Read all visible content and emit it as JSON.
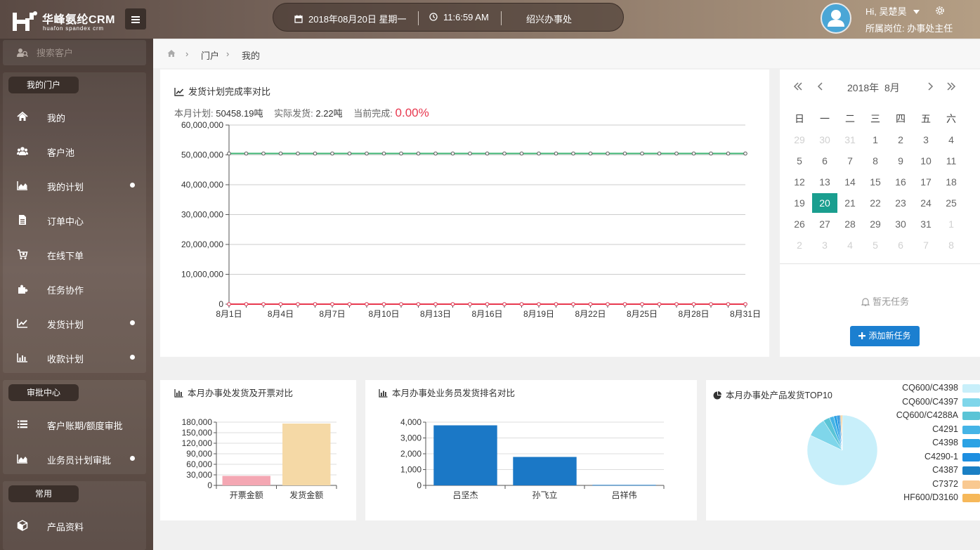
{
  "header": {
    "brand_title": "华峰氨纶CRM",
    "brand_subtitle": "huafon spandex crm",
    "menu_toggle_icon": "menu-icon",
    "date": "2018年08月20日 星期一",
    "time": "11:6:59 AM",
    "office": "绍兴办事处",
    "greeting": "Hi, 吴楚昊",
    "role": "所属岗位: 办事处主任"
  },
  "sidebar": {
    "search_placeholder": "搜索客户",
    "sections": [
      {
        "title": "我的门户",
        "items": [
          {
            "label": "我的",
            "icon": "home-icon",
            "dot": false
          },
          {
            "label": "客户池",
            "icon": "users-icon",
            "dot": false
          },
          {
            "label": "我的计划",
            "icon": "area-chart-icon",
            "dot": true
          },
          {
            "label": "订单中心",
            "icon": "document-icon",
            "dot": false
          },
          {
            "label": "在线下单",
            "icon": "cart-icon",
            "dot": false
          },
          {
            "label": "任务协作",
            "icon": "puzzle-icon",
            "dot": false
          },
          {
            "label": "发货计划",
            "icon": "line-chart-icon",
            "dot": true
          },
          {
            "label": "收款计划",
            "icon": "bar-chart-icon",
            "dot": true
          }
        ]
      },
      {
        "title": "审批中心",
        "items": [
          {
            "label": "客户账期/额度审批",
            "icon": "list-icon",
            "dot": false
          },
          {
            "label": "业务员计划审批",
            "icon": "area-chart-icon",
            "dot": true
          }
        ]
      },
      {
        "title": "常用",
        "items": [
          {
            "label": "产品资料",
            "icon": "cube-icon",
            "dot": false
          }
        ]
      }
    ]
  },
  "breadcrumb": {
    "items": [
      "门户",
      "我的"
    ]
  },
  "shipment_card": {
    "title": "发货计划完成率对比",
    "plan_label": "本月计划:",
    "plan_value": "50458.19吨",
    "actual_label": "实际发货:",
    "actual_value": "2.22吨",
    "complete_label": "当前完成:",
    "complete_value": "0.00%"
  },
  "calendar": {
    "year_label": "2018年",
    "month_label": "8月",
    "weekdays": [
      "日",
      "一",
      "二",
      "三",
      "四",
      "五",
      "六"
    ],
    "days": [
      [
        29,
        30,
        31,
        1,
        2,
        3,
        4
      ],
      [
        5,
        6,
        7,
        8,
        9,
        10,
        11
      ],
      [
        12,
        13,
        14,
        15,
        16,
        17,
        18
      ],
      [
        19,
        20,
        21,
        22,
        23,
        24,
        25
      ],
      [
        26,
        27,
        28,
        29,
        30,
        31,
        1
      ],
      [
        2,
        3,
        4,
        5,
        6,
        7,
        8
      ]
    ],
    "selected_day": 20,
    "no_task": "暂无任务",
    "add_task": "添加新任务"
  },
  "invoice_card": {
    "title": "本月办事处发货及开票对比"
  },
  "ranking_card": {
    "title": "本月办事处业务员发货排名对比"
  },
  "top10_card": {
    "title": "本月办事处产品发货TOP10"
  },
  "chart_data": [
    {
      "type": "line",
      "x": [
        "8月1日",
        "8月2日",
        "8月3日",
        "8月4日",
        "8月5日",
        "8月6日",
        "8月7日",
        "8月8日",
        "8月9日",
        "8月10日",
        "8月11日",
        "8月12日",
        "8月13日",
        "8月14日",
        "8月15日",
        "8月16日",
        "8月17日",
        "8月18日",
        "8月19日",
        "8月20日",
        "8月21日",
        "8月22日",
        "8月23日",
        "8月24日",
        "8月25日",
        "8月26日",
        "8月27日",
        "8月28日",
        "8月29日",
        "8月30日",
        "8月31日"
      ],
      "xticks": [
        "8月1日",
        "8月4日",
        "8月7日",
        "8月10日",
        "8月13日",
        "8月16日",
        "8月19日",
        "8月22日",
        "8月25日",
        "8月28日",
        "8月31日"
      ],
      "yticks": [
        "0",
        "10,000,000",
        "20,000,000",
        "30,000,000",
        "40,000,000",
        "50,000,000",
        "60,000,000"
      ],
      "ylim": [
        0,
        60000000
      ],
      "series": [
        {
          "color": "#3cb371",
          "values": [
            50458190,
            50458190,
            50458190,
            50458190,
            50458190,
            50458190,
            50458190,
            50458190,
            50458190,
            50458190,
            50458190,
            50458190,
            50458190,
            50458190,
            50458190,
            50458190,
            50458190,
            50458190,
            50458190,
            50458190,
            50458190,
            50458190,
            50458190,
            50458190,
            50458190,
            50458190,
            50458190,
            50458190,
            50458190,
            50458190,
            50458190
          ]
        },
        {
          "color": "#2a8fd6",
          "values": [
            0,
            0,
            0,
            0,
            0,
            0,
            0,
            0,
            0,
            0,
            0,
            0,
            0,
            0,
            0,
            0,
            0,
            0,
            0,
            0,
            0,
            0,
            0,
            0,
            0,
            0,
            0,
            0,
            0,
            0,
            0
          ]
        },
        {
          "color": "#e8384f",
          "values": [
            0,
            0,
            0,
            0,
            0,
            0,
            0,
            0,
            0,
            0,
            0,
            0,
            0,
            0,
            0,
            0,
            0,
            0,
            0,
            0,
            0,
            0,
            0,
            0,
            0,
            0,
            0,
            0,
            0,
            0,
            0
          ]
        }
      ],
      "grid": true
    },
    {
      "type": "bar",
      "categories": [
        "开票金额",
        "发货金额"
      ],
      "values": [
        27000,
        176000
      ],
      "colors": [
        "#f4a7b3",
        "#f5d9a6"
      ],
      "yticks": [
        "0",
        "30,000",
        "60,000",
        "90,000",
        "120,000",
        "150,000",
        "180,000"
      ],
      "ylim": [
        0,
        180000
      ],
      "grid": true
    },
    {
      "type": "bar",
      "categories": [
        "吕坚杰",
        "孙飞立",
        "吕祥伟"
      ],
      "values": [
        3800,
        1800,
        30
      ],
      "color": "#1b78c6",
      "yticks": [
        "0",
        "1,000",
        "2,000",
        "3,000",
        "4,000"
      ],
      "ylim": [
        0,
        4000
      ],
      "grid": true
    },
    {
      "type": "pie",
      "labels": [
        "CQ600/C4398",
        "CQ600/C4397",
        "CQ600/C4288A",
        "C4291",
        "C4398",
        "C4290-1",
        "C4387",
        "C7372",
        "HF600/D3160"
      ],
      "values": [
        82,
        9,
        3,
        2,
        1.5,
        1,
        0.6,
        0.5,
        0.4
      ],
      "colors": [
        "#c8effa",
        "#7fd6ea",
        "#5ac4d6",
        "#45b4e6",
        "#2ba2e4",
        "#1d8ee0",
        "#1a7fc4",
        "#f9c991",
        "#f6b85a"
      ]
    }
  ]
}
